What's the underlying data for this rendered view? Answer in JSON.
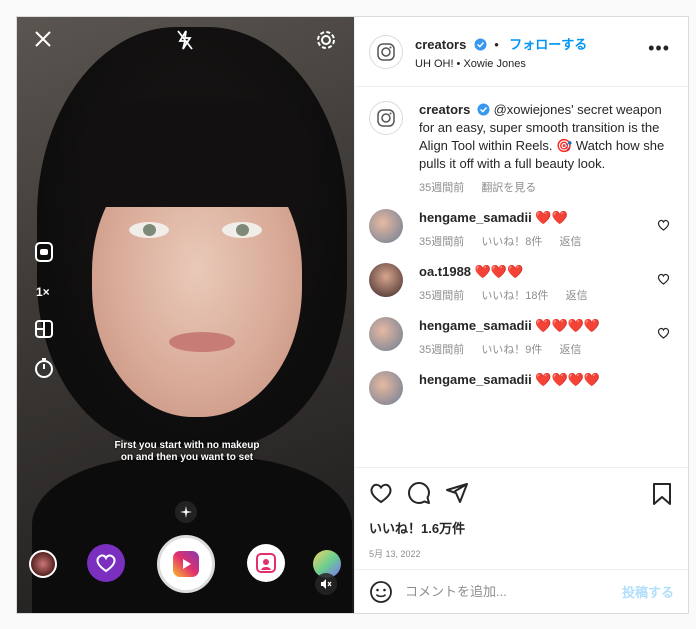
{
  "post": {
    "account": "creators",
    "follow_label": "フォローする",
    "audio_subtitle": "UH OH! • Xowie Jones",
    "more_label": "•••"
  },
  "media": {
    "overlay_caption": "First you start with no makeup on and then you want to set",
    "speed_label": "1×"
  },
  "caption": {
    "author": "creators",
    "text": "@xowiejones' secret weapon for an easy, super smooth transition is the Align Tool within Reels. 🎯 Watch how she pulls it off with a full beauty look.",
    "time": "35週間前",
    "translate_label": "翻訳を見る"
  },
  "comments": [
    {
      "user": "hengame_samadii",
      "text": "❤️❤️",
      "time": "35週間前",
      "likes": "いいね！8件",
      "reply": "返信"
    },
    {
      "user": "oa.t1988",
      "text": "❤️❤️❤️",
      "time": "35週間前",
      "likes": "いいね！18件",
      "reply": "返信"
    },
    {
      "user": "hengame_samadii",
      "text": "❤️❤️❤️❤️",
      "time": "35週間前",
      "likes": "いいね！9件",
      "reply": "返信"
    },
    {
      "user": "hengame_samadii",
      "text": "❤️❤️❤️❤️"
    }
  ],
  "footer": {
    "likes_count": "いいね！1.6万件",
    "date": "5月 13, 2022",
    "comment_placeholder": "コメントを追加...",
    "post_label": "投稿する"
  },
  "colors": {
    "accent": "#0095f6",
    "verified": "#3897f0",
    "post_disabled": "#b2dffc"
  }
}
